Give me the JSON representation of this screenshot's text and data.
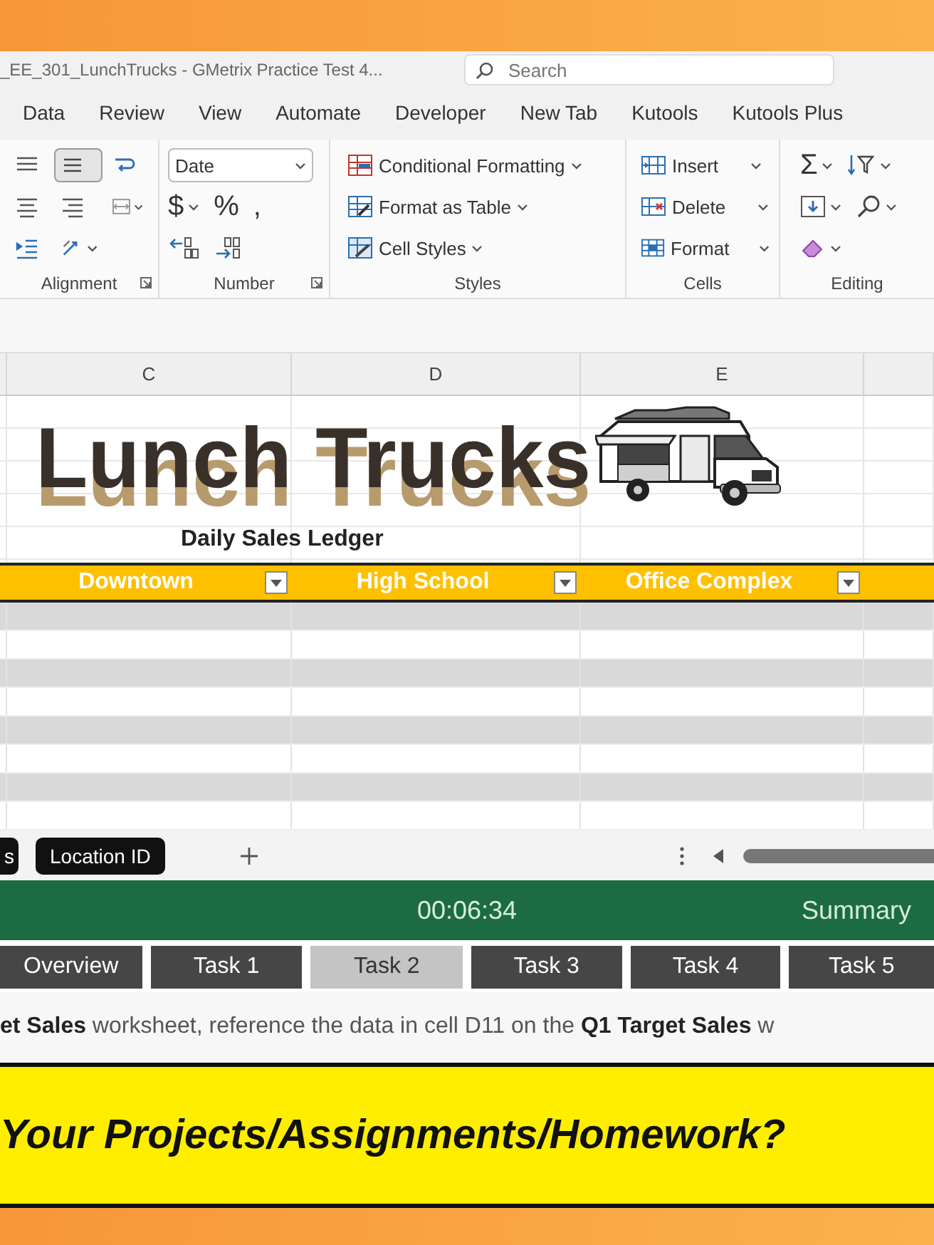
{
  "window": {
    "title": "_EE_301_LunchTrucks - GMetrix Practice Test 4..."
  },
  "search": {
    "placeholder": "Search"
  },
  "ribbon_tabs": [
    {
      "label": "Data",
      "selected": false
    },
    {
      "label": "Review",
      "selected": false
    },
    {
      "label": "View",
      "selected": false
    },
    {
      "label": "Automate",
      "selected": false
    },
    {
      "label": "Developer",
      "selected": false
    },
    {
      "label": "New Tab",
      "selected": false
    },
    {
      "label": "Kutools",
      "selected": false
    },
    {
      "label": "Kutools Plus",
      "selected": false
    }
  ],
  "ribbon": {
    "alignment": {
      "label": "Alignment",
      "buttons": [
        {
          "kind": "top-align",
          "selected": false
        },
        {
          "kind": "middle-align",
          "selected": true
        },
        {
          "kind": "wrap-text",
          "selected": false
        },
        {
          "kind": "center-align",
          "selected": false
        },
        {
          "kind": "right-align",
          "selected": false
        },
        {
          "kind": "merge",
          "selected": false
        },
        {
          "kind": "indent",
          "selected": false
        },
        {
          "kind": "orientation",
          "selected": false
        }
      ]
    },
    "number": {
      "label": "Number",
      "format": "Date",
      "symbols": [
        "$",
        "%",
        ","
      ]
    },
    "styles": {
      "label": "Styles",
      "items": [
        "Conditional Formatting",
        "Format as Table",
        "Cell Styles"
      ]
    },
    "cells": {
      "label": "Cells",
      "items": [
        "Insert",
        "Delete",
        "Format"
      ]
    },
    "editing": {
      "label": "Editing",
      "autosum": "Σ"
    }
  },
  "sheet": {
    "columns": [
      "C",
      "D",
      "E"
    ],
    "logo": "Lunch Trucks",
    "subtitle": "Daily Sales Ledger",
    "table_headers": [
      "Downtown",
      "High School",
      "Office Complex"
    ]
  },
  "sheet_tabs": [
    {
      "label": "s",
      "selected": false
    },
    {
      "label": "Location ID",
      "selected": false
    }
  ],
  "exam_bar": {
    "timer": "00:06:34",
    "summary": "Summary"
  },
  "task_tabs": [
    {
      "label": "Overview",
      "selected": false
    },
    {
      "label": "Task 1",
      "selected": false
    },
    {
      "label": "Task 2",
      "selected": true
    },
    {
      "label": "Task 3",
      "selected": false
    },
    {
      "label": "Task 4",
      "selected": false
    },
    {
      "label": "Task 5",
      "selected": false
    }
  ],
  "instruction": "**et Sales** worksheet, reference the data in cell D11 on the **Q1 Target Sales** w",
  "banner": "Your Projects/Assignments/Homework?"
}
